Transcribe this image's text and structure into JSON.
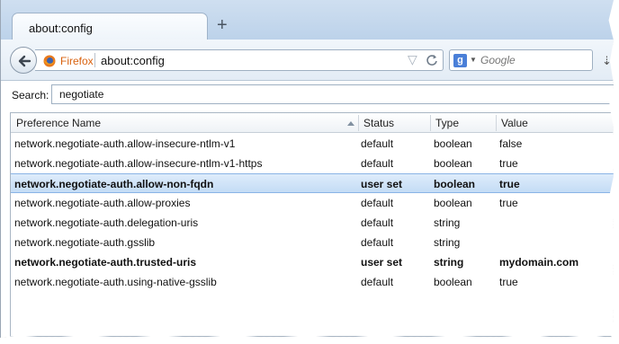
{
  "tab": {
    "title": "about:config"
  },
  "navbar": {
    "identity": "Firefox",
    "url": "about:config",
    "search_placeholder": "Google"
  },
  "filter": {
    "label": "Search:",
    "value": "negotiate"
  },
  "table": {
    "headers": {
      "name": "Preference Name",
      "status": "Status",
      "type": "Type",
      "value": "Value"
    },
    "rows": [
      {
        "name": "network.negotiate-auth.allow-insecure-ntlm-v1",
        "status": "default",
        "type": "boolean",
        "value": "false",
        "bold": false,
        "selected": false
      },
      {
        "name": "network.negotiate-auth.allow-insecure-ntlm-v1-https",
        "status": "default",
        "type": "boolean",
        "value": "true",
        "bold": false,
        "selected": false
      },
      {
        "name": "network.negotiate-auth.allow-non-fqdn",
        "status": "user set",
        "type": "boolean",
        "value": "true",
        "bold": true,
        "selected": true
      },
      {
        "name": "network.negotiate-auth.allow-proxies",
        "status": "default",
        "type": "boolean",
        "value": "true",
        "bold": false,
        "selected": false
      },
      {
        "name": "network.negotiate-auth.delegation-uris",
        "status": "default",
        "type": "string",
        "value": "",
        "bold": false,
        "selected": false
      },
      {
        "name": "network.negotiate-auth.gsslib",
        "status": "default",
        "type": "string",
        "value": "",
        "bold": false,
        "selected": false
      },
      {
        "name": "network.negotiate-auth.trusted-uris",
        "status": "user set",
        "type": "string",
        "value": "mydomain.com",
        "bold": true,
        "selected": false
      },
      {
        "name": "network.negotiate-auth.using-native-gsslib",
        "status": "default",
        "type": "boolean",
        "value": "true",
        "bold": false,
        "selected": false
      }
    ]
  },
  "colors": {
    "identity": "#d9620f",
    "selection": "#c4dcf5",
    "chrome": "#cfdff0"
  }
}
